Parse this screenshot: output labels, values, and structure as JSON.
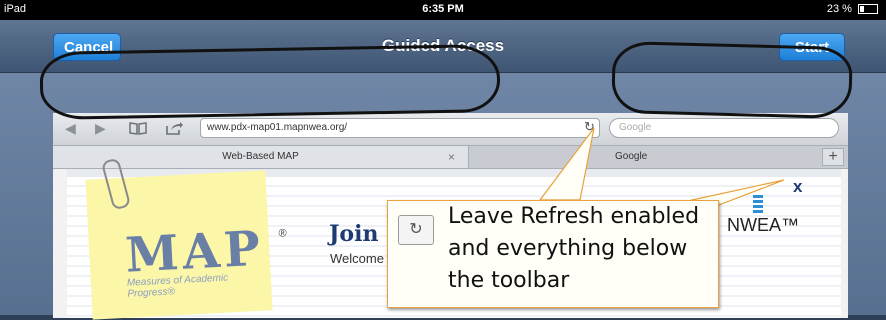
{
  "statusbar": {
    "device": "iPad",
    "time": "6:35 PM",
    "battery": "23 %"
  },
  "navbar": {
    "cancel_label": "Cancel",
    "title": "Guided Access",
    "start_label": "Start"
  },
  "browser": {
    "url": "www.pdx-map01.mapnwea.org/",
    "search_placeholder": "Google",
    "tabs": [
      {
        "label": "Web-Based MAP"
      },
      {
        "label": "Google"
      }
    ],
    "tab_close_glyph": "×",
    "tab_add_glyph": "+"
  },
  "page": {
    "logo_letters": "MAP",
    "logo_reg": "®",
    "logo_subtitle": "Measures of Academic Progress®",
    "heading": "Join",
    "welcome": "Welcome",
    "nwea": "NWEA™",
    "close_glyph": "x"
  },
  "callout": {
    "text": "Leave Refresh enabled and everything below the toolbar"
  },
  "colors": {
    "nav_gradient_top": "#5f7592",
    "button_blue": "#1e7fd8",
    "callout_border": "#e9a13c",
    "annotation_ink": "#111111"
  }
}
